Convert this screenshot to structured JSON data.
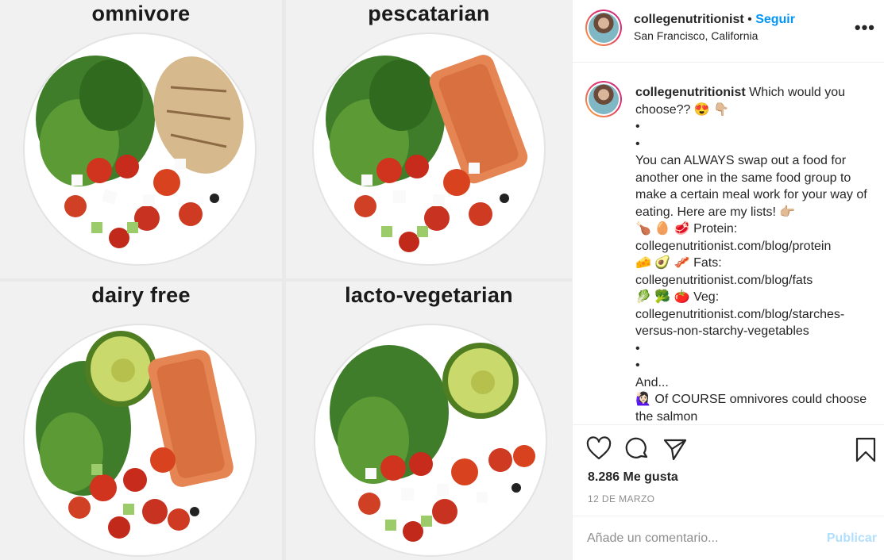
{
  "photo": {
    "quadrants": [
      {
        "title": "omnivore"
      },
      {
        "title": "pescatarian"
      },
      {
        "title": "dairy free"
      },
      {
        "title": "lacto-vegetarian"
      }
    ]
  },
  "header": {
    "username": "collegenutritionist",
    "separator": "•",
    "follow_label": "Seguir",
    "location": "San Francisco, California",
    "more_label": "•••"
  },
  "caption": {
    "username": "collegenutritionist",
    "text": " Which would you choose?? 😍 👇🏼\n•\n•\nYou can ALWAYS swap out a food for another one in the same food group to make a certain meal work for your way of eating. Here are my lists! 👉🏼\n🍗 🥚 🥩  Protein: collegenutritionist.com/blog/protein\n🧀 🥑 🥓  Fats: collegenutritionist.com/blog/fats\n🥬 🥦 🍅  Veg: collegenutritionist.com/blog/starches-versus-non-starchy-vegetables\n•\n•\nAnd...\n🙋🏻‍♀️  Of COURSE omnivores could choose the salmon"
  },
  "actions": {
    "likes": "8.286 Me gusta",
    "date": "12 DE MARZO"
  },
  "comment": {
    "placeholder": "Añade un comentario...",
    "publish_label": "Publicar"
  },
  "colors": {
    "accent": "#0095f6",
    "publish_disabled": "#b2dffc",
    "muted": "#8e8e8e"
  }
}
